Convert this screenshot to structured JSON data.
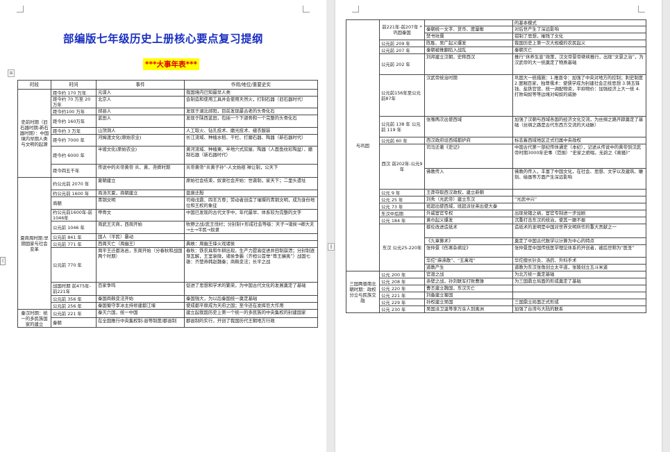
{
  "doc": {
    "title": "部编版七年级历史上册核心要点复习提纲",
    "badge": "***大事年表***"
  },
  "table1": {
    "headers": [
      "时段",
      "时间",
      "事件",
      "作用/地位/重要史实"
    ],
    "rows": [
      {
        "period": "史前时期（旧石器时期-新石器时期）：中国境内早期人类与文明的起源",
        "time": "距今约 170 万年",
        "event": "元谋人",
        "note": "我国境内已知最早人类"
      },
      {
        "time": "距今约 70 万至 20 万年",
        "event": "北京人",
        "note": "会制造和使用工具并会使用天然火，打制石器（旧石器时代）"
      },
      {
        "time": "距今约100 万年",
        "event": "郧县人",
        "note": "发现于湖北郧阳，目前发现最古老的头骨化石"
      },
      {
        "time": "距今约 160万年",
        "event": "蓝田人",
        "note": "发现于陕西蓝田，包括一个下颌骨和一个完整的头骨化石"
      },
      {
        "time": "距今约 3 万年",
        "event": "山顶洞人",
        "note": "人工取火、钻孔技术、磨光技术、缝衣服装"
      },
      {
        "time": "距今约 7000 年",
        "event": "河姆渡文化(原始农业)",
        "note": "长江流域、种植水稻、干栏、打磨石器、陶器（新石器时代）"
      },
      {
        "time": "距今约 6000 年",
        "event": "半坡文化(原始农业)",
        "note": "黄河流域、种植粟、半地穴式房屋、陶器（人面鱼纹彩陶盆）、磨制石器（新石器时代）"
      },
      {
        "time": "距今四五千年",
        "event": "传说中的炎帝黄帝 炎、黄、尧舜时期",
        "note": "炎帝黄帝“炎黄子孙”-人文始祖 禅让制，公天下"
      },
      {
        "period": "夏商周时期:早期国家与社会变革",
        "time": "约公元前 2070 年",
        "event": "夏朝建立",
        "note": "原始社会结束，奴隶社会开始：世袭制，家天下；二里头遗址"
      },
      {
        "time": "约公元前 1600 年",
        "event": "商汤灭夏，商朝建立",
        "note": "盘庚迁殷"
      },
      {
        "time": "商朝",
        "event": "青铜文明",
        "note": "司母戊鼎、四羊方尊；劳动者创造了璀璨的青铜文明，成为身份地位和王权的象征"
      },
      {
        "time": "约公元前1600年-前1046年",
        "event": "甲骨文",
        "note": "中国已发现的古代文字中，年代最早、体系较为完整的文字"
      },
      {
        "time": "公元前 1046 年",
        "event": "周武王灭商，西周开始",
        "note": "牧野之战/武王伐纣；分封制+形成社会等级：天子→诸侯→卿大夫→士→平民→奴隶"
      },
      {
        "time": "公元前 841 年",
        "event": "国人（平民）暴动",
        "note": ""
      },
      {
        "time": "公元前 771 年",
        "event": "西周灭亡（周幽王）",
        "note": "典故：周幽王烽火戏诸侯"
      },
      {
        "time": "公元前 770 年",
        "event": "周平王迁都洛邑，东周开始（分春秋和战国两个时期）",
        "note": "春秋：铁农具和牛耕出现，生产力提高促进井田制崩溃；分封制逐渐瓦解，王室衰微，诸侯争霸（齐桓公首举“尊王攘夷”）战国七雄：齐楚燕韩赵魏秦；商鞅变法；长平之战"
      },
      {
        "time": "战国时期 前475年-前221年",
        "event": "百家争鸣",
        "note": "促进了思想和学术的繁荣，为中国古代文化的发展奠定了基础"
      },
      {
        "time": "公元前 356 年",
        "event": "秦国商鞅变法开始",
        "note": "秦国强大，为以后秦国统一奠定基础"
      },
      {
        "time": "公元前 256 年",
        "event": "秦国蜀守李冰主持修建都江堰",
        "note": "使成都平原成为天府之国；至今还在发挥巨大作用"
      },
      {
        "period": "秦汉时期：统一的多民族国家的建立",
        "time": "公元前 221 年",
        "event": "秦灭六国，统一中国",
        "note": "建立起我国历史上第一个统一的多民族的中央集权的封建国家"
      },
      {
        "time": "秦朝",
        "event": "在全国推行中央集权制-县等制度/郡县制",
        "note": "郡县制的实行，开创了我国历代王朝地方行政"
      }
    ]
  },
  "table2": {
    "rows": [
      {
        "period": "与巩固",
        "time": "前221年-前207年 *巩固秦国",
        "event": "",
        "note": "的基本模式"
      },
      {
        "time": "",
        "event": "秦朝统一文字、货币、度量衡",
        "note": "对后世产生了深远影响"
      },
      {
        "time": "",
        "event": "焚书坑儒",
        "note": "钳制了思想，摧残了文化"
      },
      {
        "time": "公元前 209 年",
        "event": "陈胜、吴广起义爆发",
        "note": "我国历史上第一次大规模的农民起义"
      },
      {
        "time": "公元前 207 年",
        "event": "秦朝被推翻陷入战乱",
        "note": "秦朝灭亡"
      },
      {
        "time": "公元前 202 年",
        "event": "刘邦建立汉朝，史称西汉",
        "note": "推行“休养生息”政策，汉文帝景帝继续推行，出现“文景之治”，为汉武帝的大一统奠定了物质基础"
      },
      {
        "time": "公元前156年至公元前87年",
        "event": "汉武帝统治时期",
        "note": "巩固大一统措施：1.推恩令：加强了中央对地方的控制；刺史制度 2.罢黜百家，独尊儒术：使儒学成为封建社会正统思想 3.铸五铢钱、盐铁官营、统一调配物资，平抑物价：加强经济上大一统 4.打败匈奴等等边境对匈奴的威胁"
      },
      {
        "time": "公元前 138 年 公元前 119 年",
        "event": "张骞两次出使西域",
        "note": "加强了汉朝与西域各国的经济文化交流，为丝绸之路开辟奠定了基础（丝绸之路是古代东西方交流的大动脉）"
      },
      {
        "time": "公元前 60 年",
        "event": "西汉政府设西域都护府",
        "note": "标志着西域地区正式归属中央政权"
      },
      {
        "time": "西汉 前202年-公元9年",
        "event": "司马迁著《史记》",
        "note": "中国古代第一部纪传体通史（本纪），记述从传说中的黄帝到汉武帝时期3000年史事（范围）“史家之绝唱，无韵之《离骚》”"
      },
      {
        "time": "",
        "event": "佛教传入",
        "note": "佛教的传入，丰富了中国文化，在社会、思想、文学以及建筑、雕刻、绘画等方面产生深远影响"
      },
      {
        "time": "公元 9 年",
        "event": "王莽夺取西汉政权，建立新朝",
        "note": ""
      },
      {
        "time": "公元 25 年",
        "event": "刘秀（光武帝）建立东汉",
        "note": "“光武中兴”"
      },
      {
        "time": "公元 73 年",
        "event": "班超出使西域，班超派甘英出使大秦",
        "note": ""
      },
      {
        "time": "东汉中后期",
        "event": "外戚宦官专权",
        "note": "出现党锢之祸，宦官专制进一步加剧"
      },
      {
        "time": "公元 184 年",
        "event": "黄巾起义爆发",
        "note": "沉重打击东汉的统治，使其一蹶不振"
      },
      {
        "time": "东汉 公元25-220年",
        "event": "蔡伦改进造纸术",
        "note": "造纸术的发明是中国对世界文明所作的重大贡献之一"
      },
      {
        "time": "",
        "event": "《九章算术》",
        "note": "奠定了中国古代数学以计算为中心的特点"
      },
      {
        "time": "",
        "event": "张仲景《伤寒杂病论》",
        "note": "张仲景是中国传统医学理论体系的开创者，被后世称为“医圣”"
      },
      {
        "time": "",
        "event": "华佗“麻沸散”、“五禽戏”",
        "note": "华佗擅长针灸、汤药、外科手术"
      },
      {
        "time": "",
        "event": "道教产生",
        "note": "道教为东汉张角创立太平道，张陵创立五斗米道"
      },
      {
        "period": "三国两晋南北朝时期：政权分立与民族交融",
        "time": "公元 200 年",
        "event": "官渡之战",
        "note": "为北方统一奠定基础"
      },
      {
        "time": "公元 208 年",
        "event": "赤壁之战，孙刘联军打败曹操",
        "note": "为三国鼎立局面的形成奠定了基础"
      },
      {
        "time": "公元 220 年",
        "event": "曹丕建立魏国，东汉灭亡",
        "note": ""
      },
      {
        "time": "公元 221 年",
        "event": "刘备建立蜀国",
        "note": ""
      },
      {
        "time": "公元 229 年",
        "event": "孙权建立吴国",
        "note": "三国鼎立局面正式形成"
      },
      {
        "time": "公元 230 年",
        "event": "吴国派卫温等率万余人到夷洲",
        "note": "加强了台湾与大陆的联系"
      }
    ]
  }
}
